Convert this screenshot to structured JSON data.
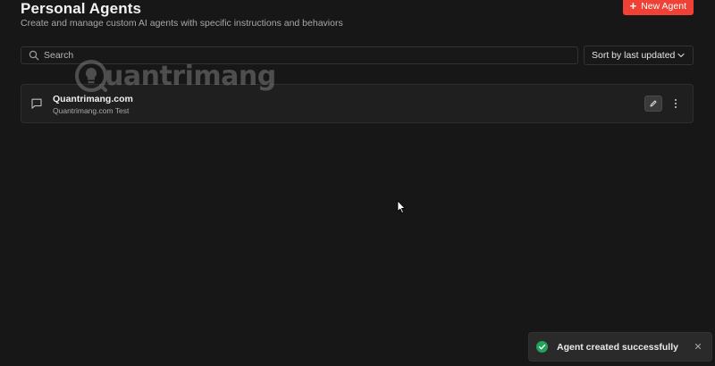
{
  "header": {
    "title": "Personal Agents",
    "subtitle": "Create and manage custom AI agents with specific instructions and behaviors",
    "new_agent_label": "New Agent",
    "new_agent_icon": "plus-icon"
  },
  "toolbar": {
    "search_placeholder": "Search",
    "search_value": "",
    "sort_selected": "Sort by last updated"
  },
  "agents": [
    {
      "name": "Quantrimang.com",
      "description": "Quantrimang.com Test",
      "icon": "chat-icon"
    }
  ],
  "toast": {
    "message": "Agent created successfully",
    "status_color": "#22a35a"
  },
  "watermark": {
    "text": "uantrimang"
  },
  "colors": {
    "accent": "#ef4136",
    "background": "#171717",
    "card": "#1f1f1f"
  }
}
